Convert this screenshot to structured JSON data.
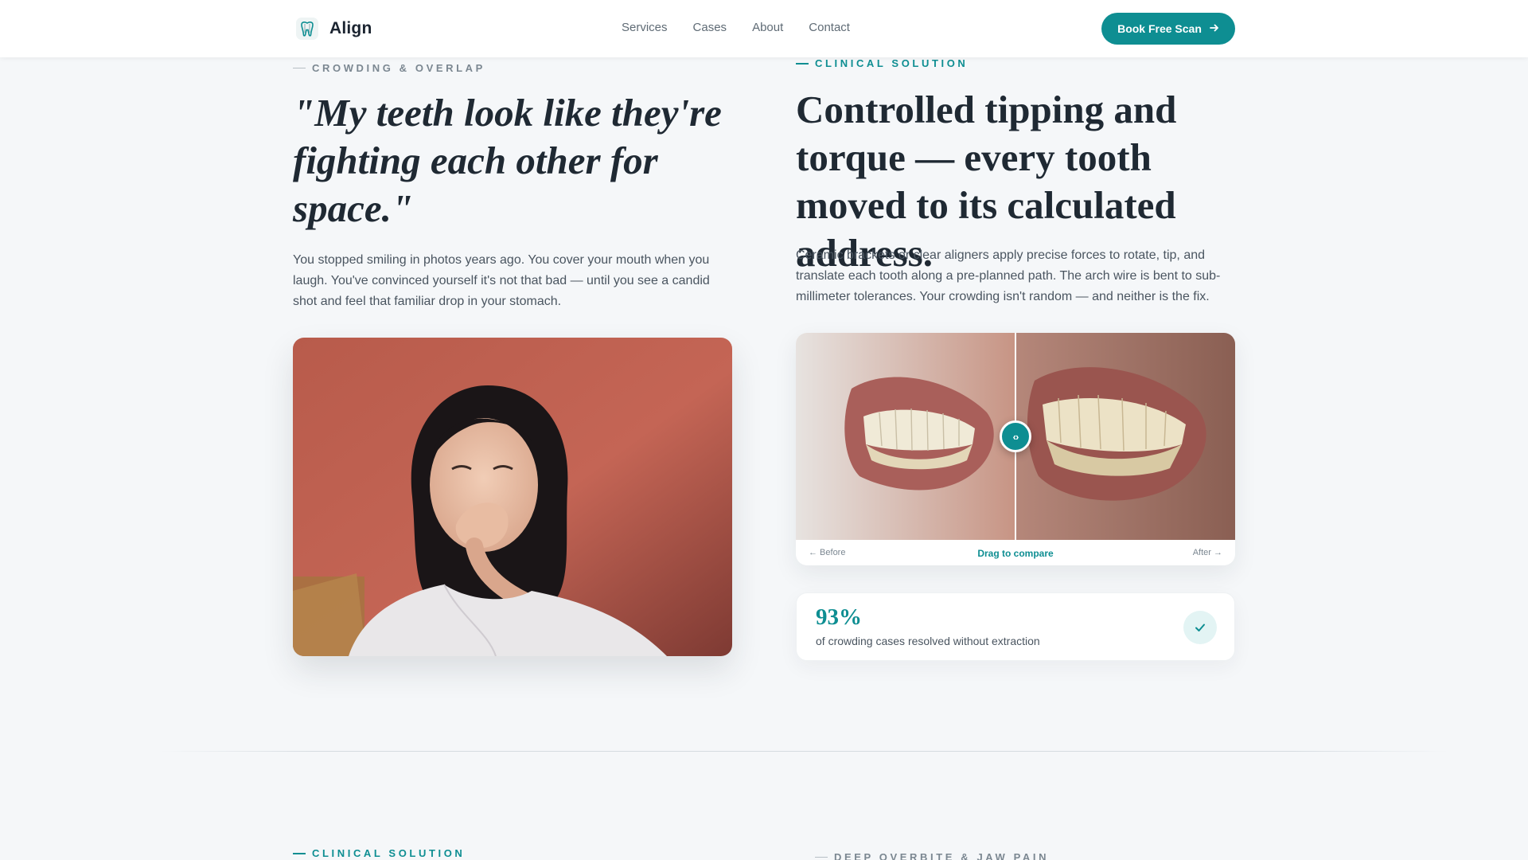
{
  "brand": {
    "name": "Align",
    "accent": "#0e8e92"
  },
  "nav": {
    "items": [
      "Services",
      "Cases",
      "About",
      "Contact"
    ]
  },
  "header": {
    "cta_label": "Book Free Scan",
    "cta_icon": "arrow-right-icon"
  },
  "left": {
    "eyebrow": "CROWDING & OVERLAP",
    "quote": "\"My teeth look like they're fighting each other for space.\"",
    "body": "You stopped smiling in photos years ago. You cover your mouth when you laugh. You've convinced yourself it's not that bad — until you see a candid shot and feel that familiar drop in your stomach."
  },
  "right": {
    "eyebrow": "CLINICAL SOLUTION",
    "headline": "Controlled tipping and torque — every tooth moved to its calculated address.",
    "body": "Ceramic brackets or clear aligners apply precise forces to rotate, tip, and translate each tooth along a pre-planned path. The arch wire is bent to sub-millimeter tolerances. Your crowding isn't random — and neither is the fix.",
    "compare": {
      "handle_label": "‹›",
      "before_label": "← Before",
      "drag_label": "Drag to compare",
      "after_label": "After →"
    },
    "stat": {
      "value": "93%",
      "label": "of crowding cases resolved without extraction",
      "icon": "check-icon"
    }
  },
  "next_section": {
    "left_eyebrow": "CLINICAL SOLUTION",
    "right_eyebrow": "DEEP OVERBITE & JAW PAIN"
  }
}
